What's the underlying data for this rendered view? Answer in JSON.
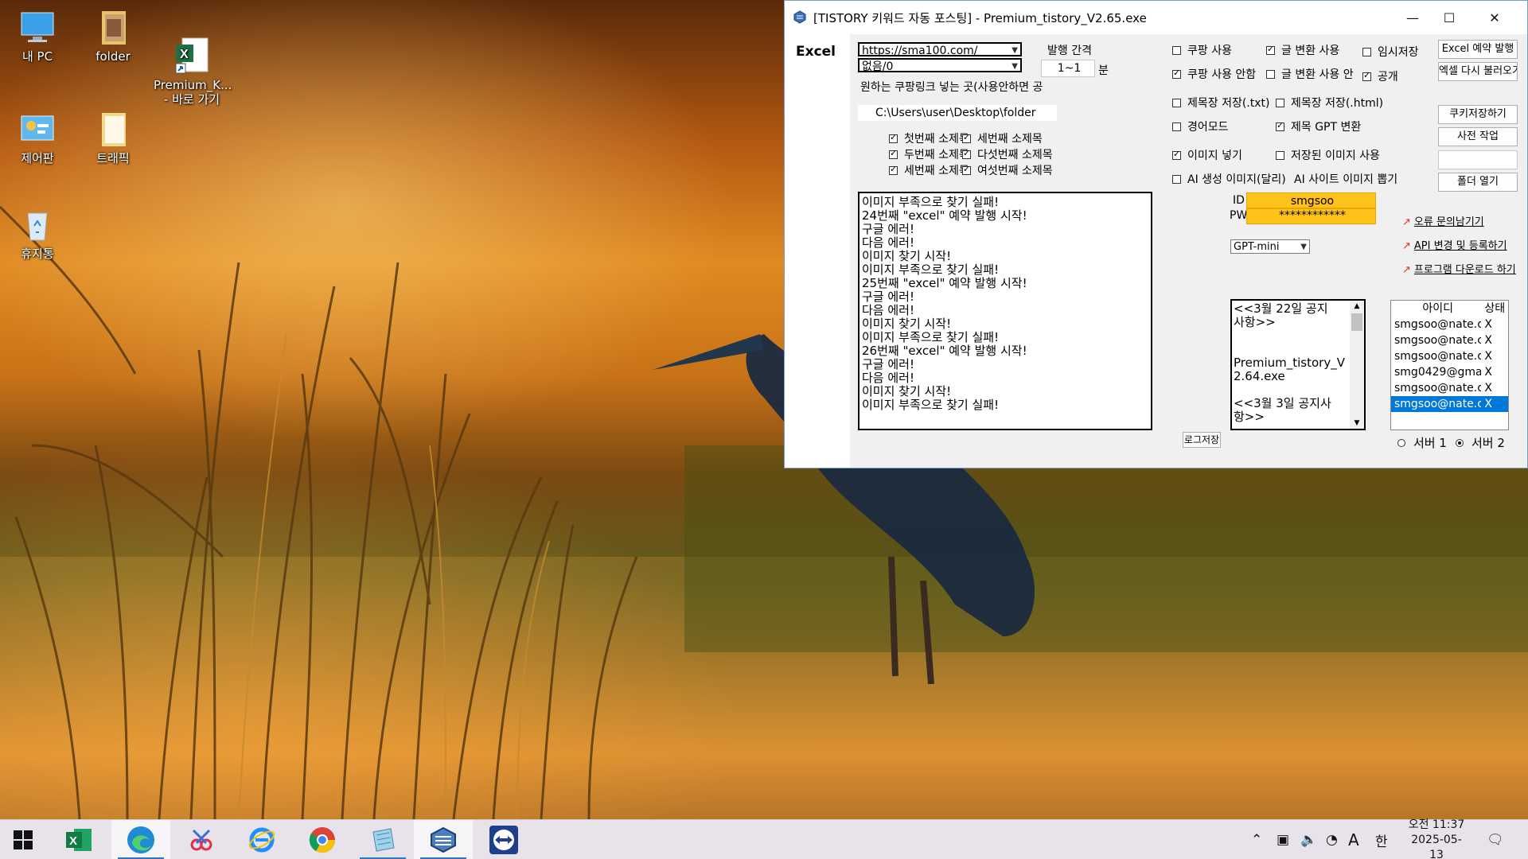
{
  "desktop": {
    "icons": [
      {
        "label": "내 PC",
        "icon": "computer-icon"
      },
      {
        "label": "folder",
        "icon": "folder-icon"
      },
      {
        "label": "Premium_K...\n- 바로 가기",
        "icon": "excel-shortcut-icon"
      },
      {
        "label": "제어판",
        "icon": "control-panel-icon"
      },
      {
        "label": "트래픽",
        "icon": "folder-icon"
      },
      {
        "label": "휴지통",
        "icon": "recycle-bin-icon"
      }
    ]
  },
  "window": {
    "title": "[TISTORY 키워드 자동 포스팅] - Premium_tistory_V2.65.exe",
    "left_tab": "Excel",
    "url_combo": "https://sma100.com/",
    "category_combo": "없음/0",
    "interval_label": "발행 간격",
    "interval_value": "1~1",
    "interval_unit": "분",
    "coupang_hint": "원하는 쿠팡링크 넣는 곳(사용안하면 공",
    "folder_path": "C:\\Users\\user\\Desktop\\folder",
    "subtitles": [
      {
        "label": "첫번째 소제목",
        "checked": true
      },
      {
        "label": "세번째 소제목",
        "checked": true
      },
      {
        "label": "두번째 소제목",
        "checked": true
      },
      {
        "label": "다섯번째 소제목",
        "checked": true
      },
      {
        "label": "세번째 소제목",
        "checked": true
      },
      {
        "label": "여섯번째 소제목",
        "checked": true
      }
    ],
    "options": {
      "coupang_use": "쿠팡 사용",
      "text_convert": "글 변환 사용",
      "temp_save": "임시저장",
      "coupang_nouse": "쿠팡 사용 안함",
      "text_convert2": "글 변환 사용 안",
      "public": "공개",
      "title_save_txt": "제목장 저장(.txt)",
      "title_save_html": "제목장 저장(.html)",
      "gyeong_mode": "경어모드",
      "title_gpt": "제목 GPT 변환",
      "image_insert": "이미지 넣기",
      "saved_image": "저장된 이미지 사용",
      "ai_image": "AI 생성 이미지(달리)",
      "site_image": "AI 사이트 이미지 뽑기"
    },
    "buttons": {
      "excel_reserve": "Excel 예약 발행",
      "excel_reload": "엑셀 다시 불러오기",
      "cookie_save": "쿠키저장하기",
      "pre_work": "사전 작업",
      "folder_open": "폴더 열기",
      "log_save": "로그저장"
    },
    "id_label": "ID",
    "pw_label": "PW",
    "id_value": "smgsoo",
    "pw_value": "************",
    "model_combo": "GPT-mini",
    "links": [
      "오류 문의남기기",
      "API 변경 및 등록하기",
      "프로그램 다운로드 하기"
    ],
    "log_lines": [
      "이미지 부족으로 찾기 실패!",
      "24번째 \"excel\" 예약 발행 시작!",
      "구글 에러!",
      "다음 에러!",
      "이미지 찾기 시작!",
      "이미지 부족으로 찾기 실패!",
      "25번째 \"excel\" 예약 발행 시작!",
      "구글 에러!",
      "다음 에러!",
      "이미지 찾기 시작!",
      "이미지 부족으로 찾기 실패!",
      "26번째 \"excel\" 예약 발행 시작!",
      "구글 에러!",
      "다음 에러!",
      "이미지 찾기 시작!",
      "이미지 부족으로 찾기 실패!"
    ],
    "notice_lines": [
      "<<3월 22일 공지",
      "사항>>",
      "",
      "",
      "Premium_tistory_V",
      "2.64.exe",
      "",
      "<<3월 3일 공지사",
      "항>>"
    ],
    "accounts": {
      "col_id": "아이디",
      "col_status": "상태",
      "rows": [
        {
          "id": "smgsoo@nate.c",
          "status": "X"
        },
        {
          "id": "smgsoo@nate.c",
          "status": "X"
        },
        {
          "id": "smgsoo@nate.c",
          "status": "X"
        },
        {
          "id": "smg0429@gma",
          "status": "X"
        },
        {
          "id": "smgsoo@nate.c",
          "status": "X"
        },
        {
          "id": "smgsoo@nate.c",
          "status": "X"
        }
      ]
    },
    "server1": "서버 1",
    "server2": "서버 2"
  },
  "taskbar": {
    "apps": [
      "start-icon",
      "excel-icon",
      "edge-icon",
      "snip-icon",
      "ie-icon",
      "chrome-icon",
      "notepad-icon",
      "tistory-app-icon",
      "teamviewer-icon"
    ],
    "time": "오전 11:37",
    "date": "2025-05-13",
    "ime_a": "A",
    "ime_lang": "한"
  },
  "colors": {
    "id_field_bg": "#ffc21a",
    "selection": "#0078d7",
    "taskbar_accent": "#2e74c9"
  }
}
